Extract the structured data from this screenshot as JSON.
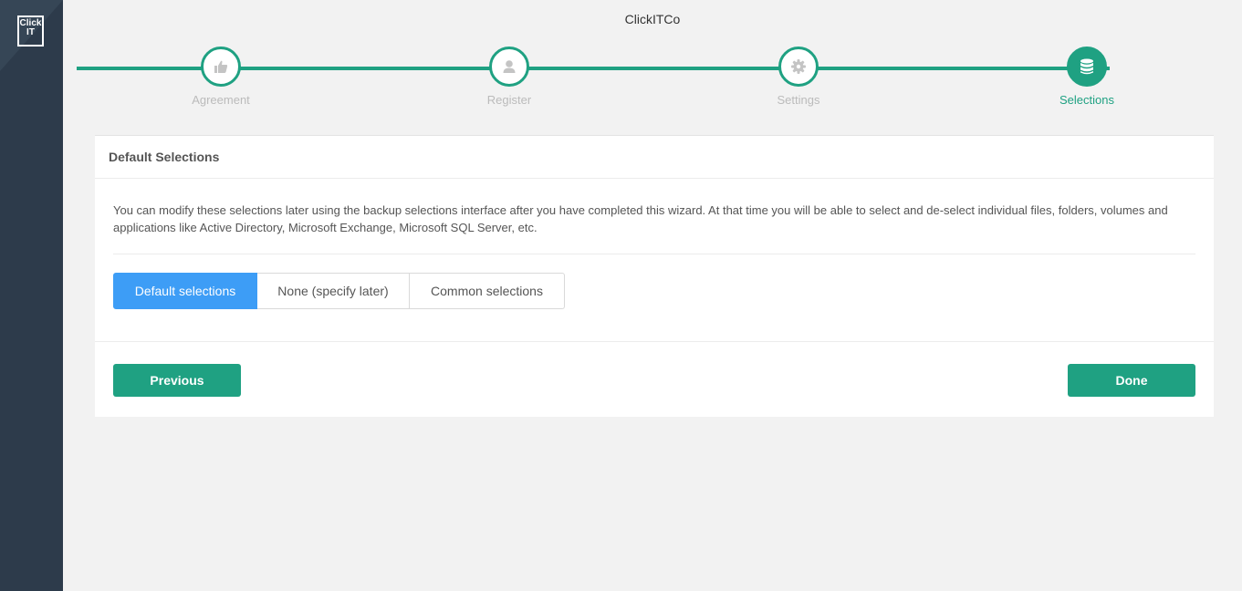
{
  "app": {
    "logo_text_line1": "Click",
    "logo_text_line2": "IT",
    "company": "ClickITCo"
  },
  "wizard": {
    "steps": [
      {
        "label": "Agreement",
        "icon": "thumbs-up-icon",
        "state": "completed"
      },
      {
        "label": "Register",
        "icon": "user-icon",
        "state": "completed"
      },
      {
        "label": "Settings",
        "icon": "gear-icon",
        "state": "completed"
      },
      {
        "label": "Selections",
        "icon": "database-icon",
        "state": "active"
      }
    ]
  },
  "panel": {
    "title": "Default Selections",
    "description": "You can modify these selections later using the backup selections interface after you have completed this wizard. At that time you will be able to select and de-select individual files, folders, volumes and applications like Active Directory, Microsoft Exchange, Microsoft SQL Server, etc.",
    "options": [
      {
        "label": "Default selections",
        "selected": true
      },
      {
        "label": "None (specify later)",
        "selected": false
      },
      {
        "label": "Common selections",
        "selected": false
      }
    ],
    "previous_label": "Previous",
    "done_label": "Done"
  },
  "colors": {
    "accent": "#1fa182",
    "selected_option": "#3d9df6",
    "sidebar": "#2d3b4b"
  }
}
